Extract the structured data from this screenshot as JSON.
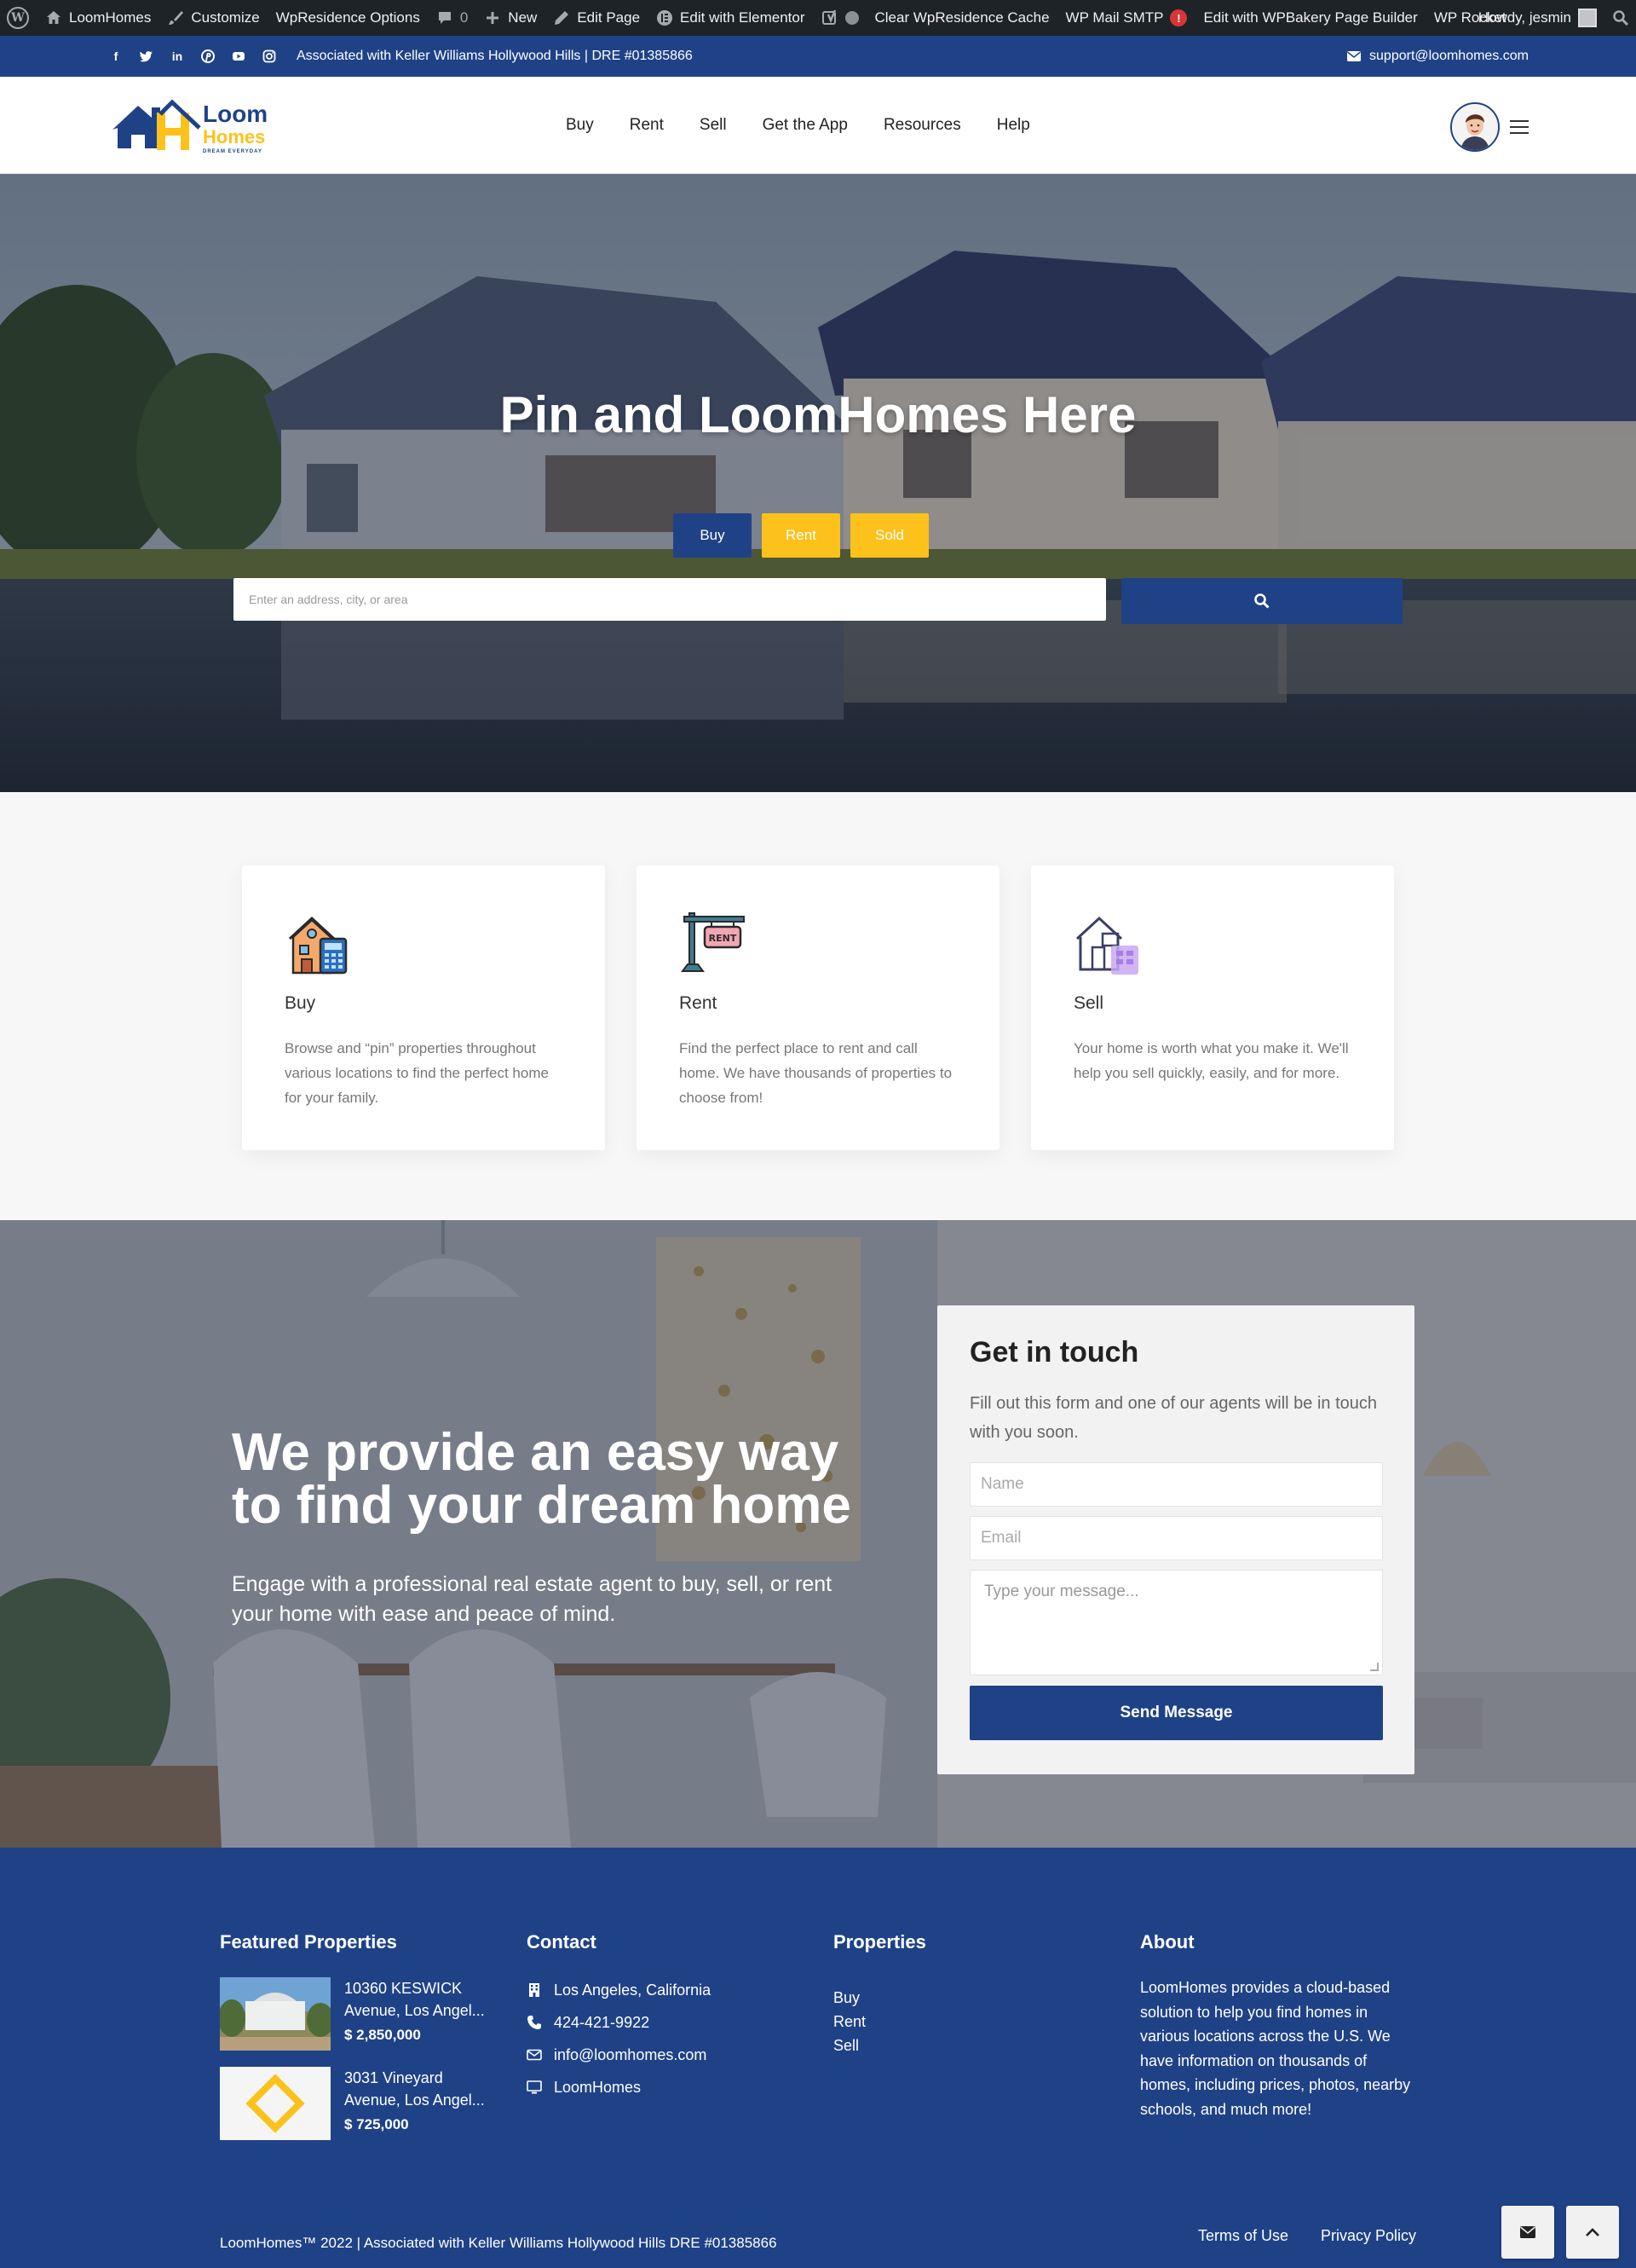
{
  "admin_bar": {
    "site_name": "LoomHomes",
    "customize": "Customize",
    "wpresidence_options": "WpResidence Options",
    "comments_count": "0",
    "new": "New",
    "edit_page": "Edit Page",
    "edit_elementor": "Edit with Elementor",
    "clear_cache": "Clear WpResidence Cache",
    "wp_mail_smtp": "WP Mail SMTP",
    "smtp_alert": "!",
    "edit_wpbakery": "Edit with WPBakery Page Builder",
    "wp_rocket": "WP Rocket",
    "howdy": "Howdy, jesmin"
  },
  "topbar": {
    "association": "Associated with Keller Williams Hollywood Hills | DRE #01385866",
    "email": "support@loomhomes.com",
    "social_icons": [
      "facebook-icon",
      "twitter-icon",
      "linkedin-icon",
      "pinterest-icon",
      "youtube-icon",
      "instagram-icon"
    ]
  },
  "header": {
    "logo": {
      "line1": "Loom",
      "line2": "Homes",
      "tagline": "DREAM EVERYDAY"
    },
    "nav": [
      "Buy",
      "Rent",
      "Sell",
      "Get the App",
      "Resources",
      "Help"
    ]
  },
  "hero": {
    "title": "Pin and LoomHomes Here",
    "tabs": [
      "Buy",
      "Rent",
      "Sold"
    ],
    "search_placeholder": "Enter an address, city, or area"
  },
  "features": [
    {
      "title": "Buy",
      "description": "Browse and “pin” properties throughout various locations to find the perfect home for your family."
    },
    {
      "title": "Rent",
      "description": "Find the perfect place to rent and call home. We have thousands of properties to choose from!"
    },
    {
      "title": "Sell",
      "description": "Your home is worth what you make it. We'll help you sell quickly, easily, and for more."
    }
  ],
  "contact_band": {
    "heading": "We provide an easy way to find your dream home",
    "subheading": "Engage with a professional real estate agent to buy, sell, or rent your home with ease and peace of mind.",
    "form": {
      "title": "Get in touch",
      "description": "Fill out this form and one of our agents will be in touch with you soon.",
      "name_placeholder": "Name",
      "email_placeholder": "Email",
      "message_placeholder": "Type your message...",
      "submit": "Send Message"
    }
  },
  "footer": {
    "featured_title": "Featured Properties",
    "properties": [
      {
        "address": "10360 KESWICK Avenue, Los Angel...",
        "price": "$ 2,850,000"
      },
      {
        "address": "3031 Vineyard Avenue, Los Angel...",
        "price": "$ 725,000"
      }
    ],
    "contact_title": "Contact",
    "contact": [
      {
        "icon": "building-icon",
        "text": "Los Angeles, California"
      },
      {
        "icon": "phone-icon",
        "text": "424-421-9922"
      },
      {
        "icon": "envelope-icon",
        "text": "info@loomhomes.com"
      },
      {
        "icon": "desktop-icon",
        "text": "LoomHomes"
      }
    ],
    "properties_title": "Properties",
    "property_links": [
      "Buy",
      "Rent",
      "Sell"
    ],
    "about_title": "About",
    "about_text": "LoomHomes provides a cloud-based solution to help you find homes in various locations across the U.S. We have information on thousands of homes, including prices, photos, nearby schools, and much more!",
    "copyright": "LoomHomes™ 2022 | Associated with Keller Williams Hollywood Hills DRE #01385866",
    "terms": "Terms of Use",
    "privacy": "Privacy Policy"
  },
  "colors": {
    "brand_blue": "#1f4287",
    "brand_yellow": "#fcc21b",
    "admin_bar": "#1d2327"
  }
}
